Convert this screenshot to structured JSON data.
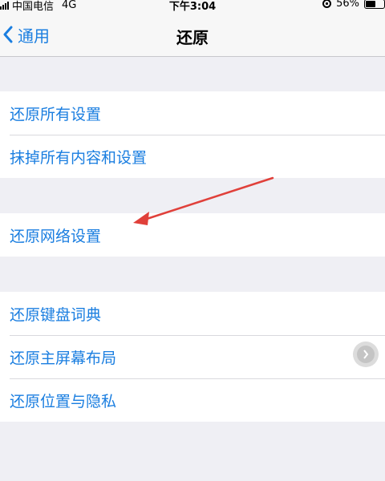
{
  "status_bar": {
    "carrier": "中国电信",
    "network": "4G",
    "time": "下午3:04",
    "battery_level": "56%",
    "battery_fraction": 0.56
  },
  "nav": {
    "back_label": "通用",
    "title": "还原"
  },
  "groups": [
    {
      "items": [
        {
          "label": "还原所有设置"
        },
        {
          "label": "抹掉所有内容和设置"
        }
      ]
    },
    {
      "items": [
        {
          "label": "还原网络设置"
        }
      ]
    },
    {
      "items": [
        {
          "label": "还原键盘词典"
        },
        {
          "label": "还原主屏幕布局"
        },
        {
          "label": "还原位置与隐私"
        }
      ]
    }
  ],
  "colors": {
    "accent": "#1a7ee0",
    "background": "#efeff4",
    "annotation": "#e0403a"
  },
  "icons": {
    "back": "chevron-left-icon",
    "assistive_touch": "assistive-touch-icon",
    "orientation_lock": "orientation-lock-icon",
    "battery": "battery-icon",
    "signal": "signal-icon"
  }
}
